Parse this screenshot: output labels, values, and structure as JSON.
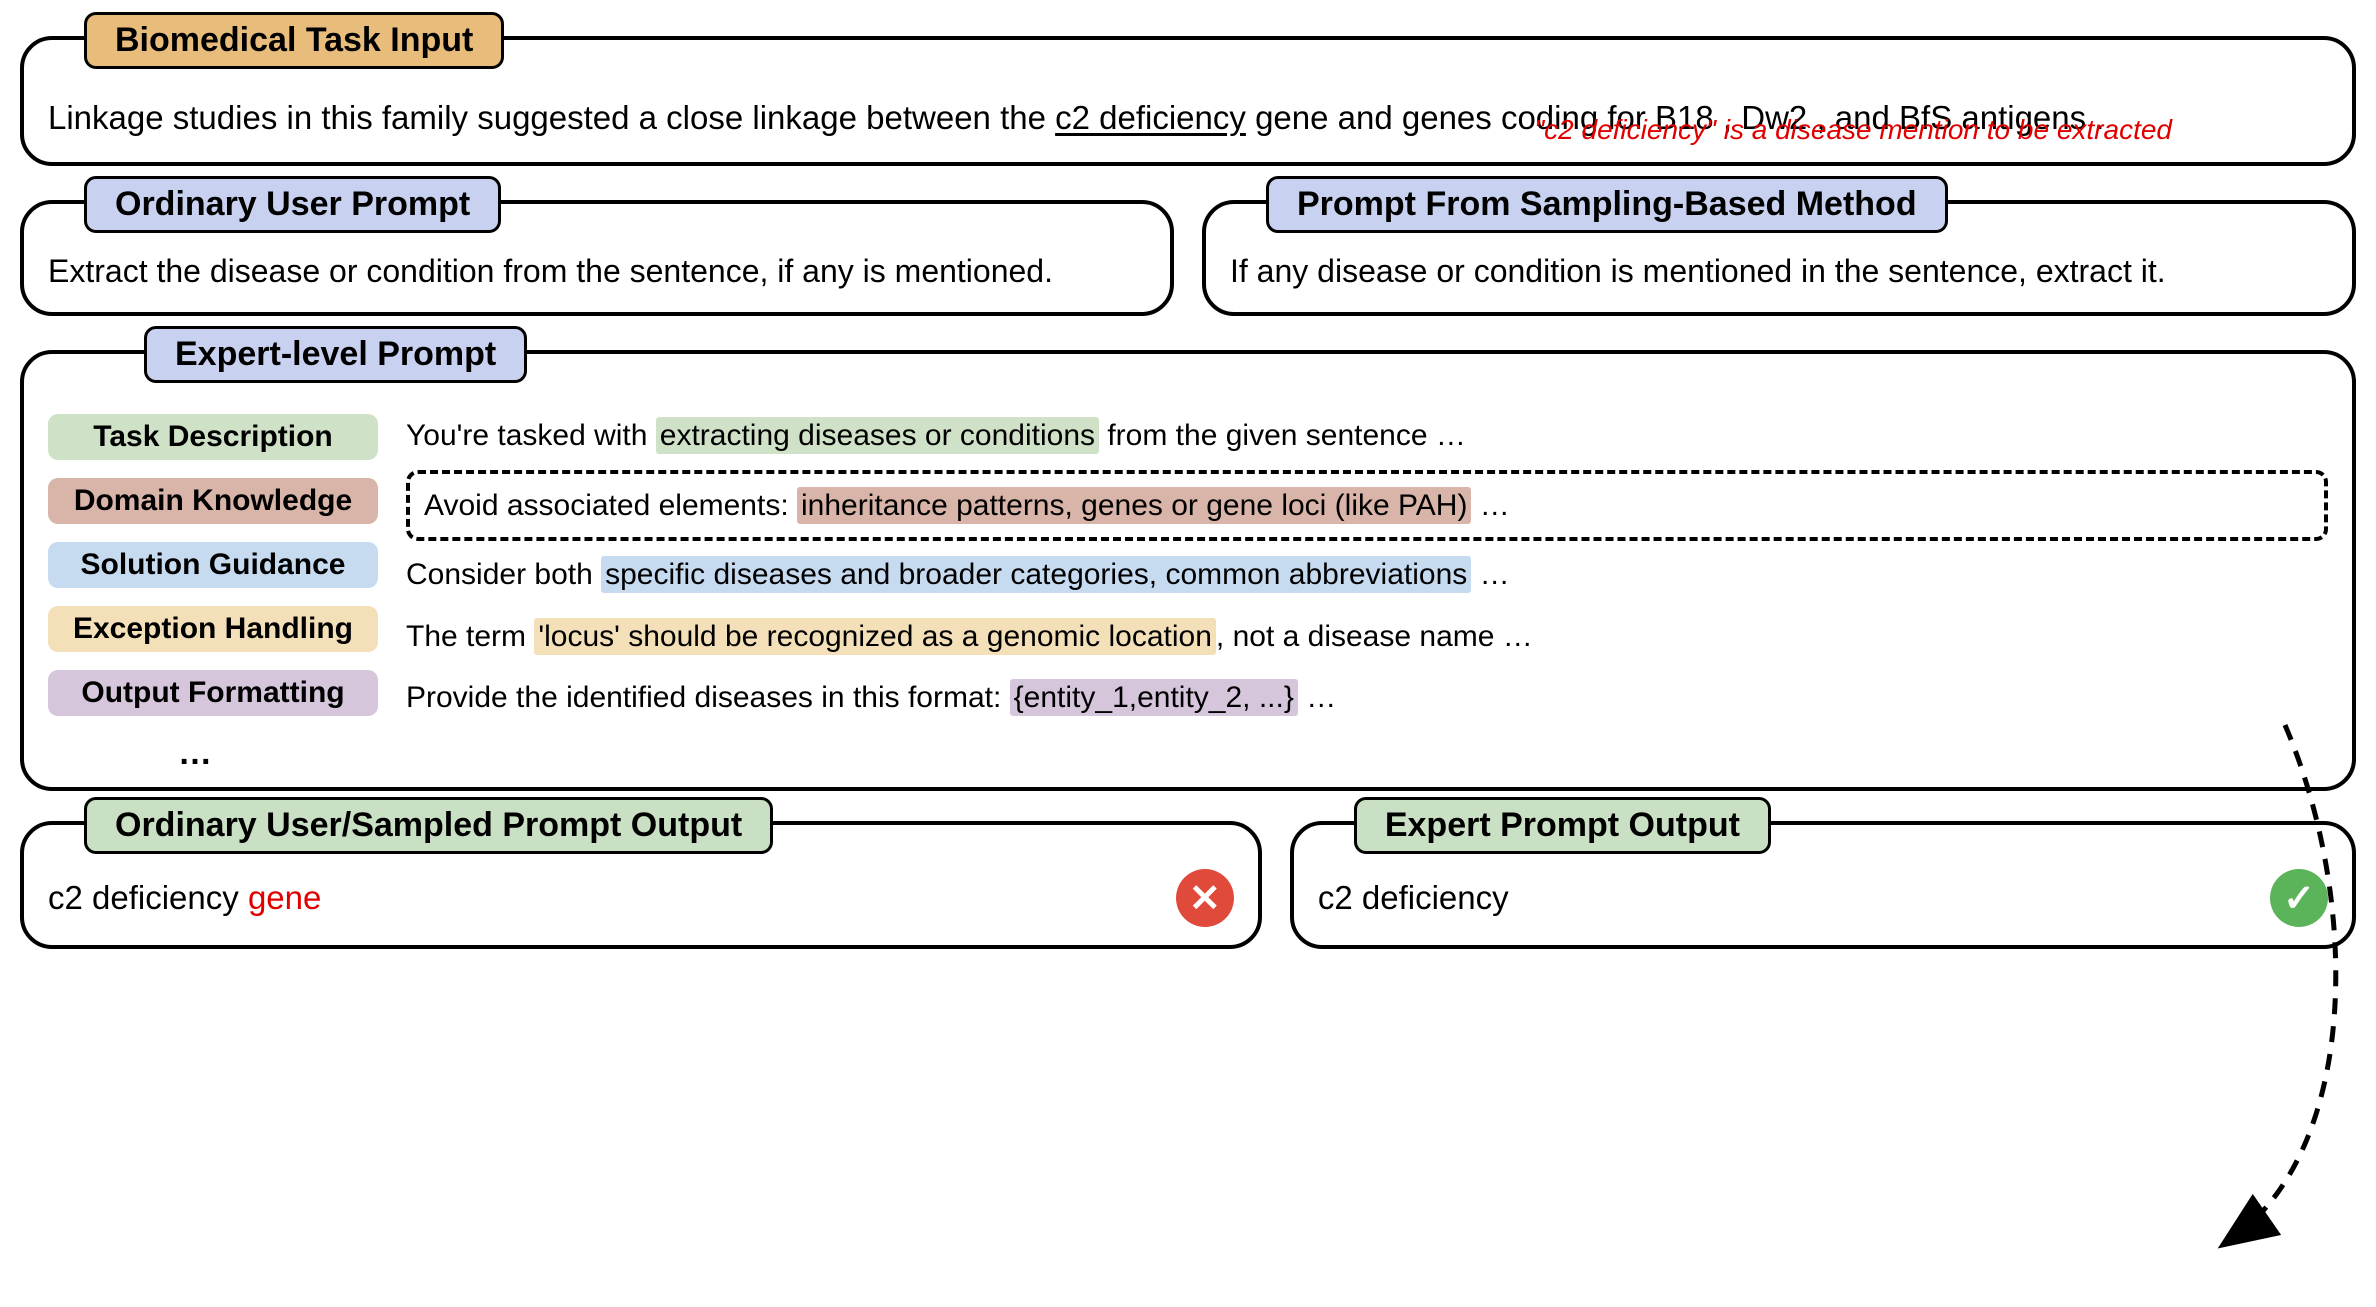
{
  "top": {
    "badge": "Biomedical Task Input",
    "text_before": "Linkage studies in this family suggested a close linkage between the ",
    "underlined": "c2 deficiency",
    "text_after": " gene and genes coding for B18 , Dw2 , and BfS antigens .",
    "annotation": "\"c2 deficiency\" is a disease mention to be extracted"
  },
  "ordinary": {
    "badge": "Ordinary User Prompt",
    "text": "Extract the disease or condition from the sentence, if any is mentioned."
  },
  "sampling": {
    "badge": "Prompt From Sampling-Based Method",
    "text": "If any disease or condition is mentioned in the sentence, extract it."
  },
  "expert": {
    "badge": "Expert-level Prompt",
    "legend": {
      "task": "Task Description",
      "domain": "Domain Knowledge",
      "solution": "Solution Guidance",
      "exception": "Exception Handling",
      "output": "Output Formatting"
    },
    "rows": {
      "task": {
        "pre": "You're tasked with ",
        "hl": "extracting diseases or conditions",
        "post": " from the given sentence …"
      },
      "domain": {
        "pre": "Avoid associated elements: ",
        "hl": "inheritance patterns, genes or gene loci (like PAH)",
        "post": " …"
      },
      "solution": {
        "pre": "Consider both ",
        "hl": "specific diseases and broader categories, common abbreviations",
        "post": " …"
      },
      "exception": {
        "pre": "The term ",
        "hl": "'locus' should be recognized as a genomic location",
        "post": ", not a disease name …"
      },
      "output": {
        "pre": "Provide the identified diseases in this format: ",
        "hl": "{entity_1,entity_2, ...}",
        "post": " …"
      }
    },
    "ellipsis": "…"
  },
  "output_left": {
    "badge": "Ordinary User/Sampled Prompt Output",
    "text_main": "c2 deficiency ",
    "text_wrong": "gene"
  },
  "output_right": {
    "badge": "Expert Prompt Output",
    "text": "c2 deficiency"
  },
  "colors": {
    "orange": "#e8bc7b",
    "blue": "#c8d1ef",
    "green": "#cae0c4",
    "hl_task": "#cfe2c8",
    "hl_domain": "#d9b4a9",
    "hl_solution": "#c6daf0",
    "hl_exception": "#f3dfb8",
    "hl_output": "#d6c6dc",
    "red": "#e00000"
  },
  "icons": {
    "wrong": "cross-icon",
    "right": "check-icon"
  }
}
